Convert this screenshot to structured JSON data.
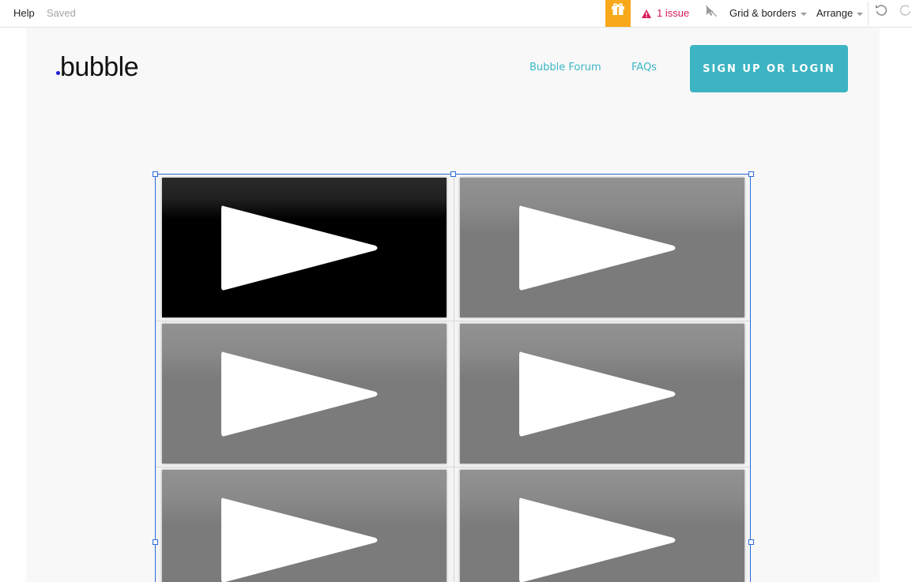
{
  "toolbar": {
    "help_label": "Help",
    "status_label": "Saved",
    "gift_icon": "gift-icon",
    "issues_label": "1 issue",
    "issues_color": "#d9185b",
    "grid_label": "Grid & borders",
    "arrange_label": "Arrange"
  },
  "page": {
    "logo_text": "bubble",
    "nav": {
      "forum_label": "Bubble Forum",
      "faq_label": "FAQs"
    },
    "cta_label": "SIGN UP OR LOGIN",
    "accent_color": "#3cb4c3"
  },
  "video_grid": {
    "rows": 3,
    "columns": 2,
    "items": [
      {
        "style": "dark",
        "icon": "play-icon"
      },
      {
        "style": "gray",
        "icon": "play-icon"
      },
      {
        "style": "gray",
        "icon": "play-icon"
      },
      {
        "style": "gray",
        "icon": "play-icon"
      },
      {
        "style": "gray",
        "icon": "play-icon"
      },
      {
        "style": "gray",
        "icon": "play-icon"
      }
    ],
    "selection_color": "#2b69d8"
  }
}
